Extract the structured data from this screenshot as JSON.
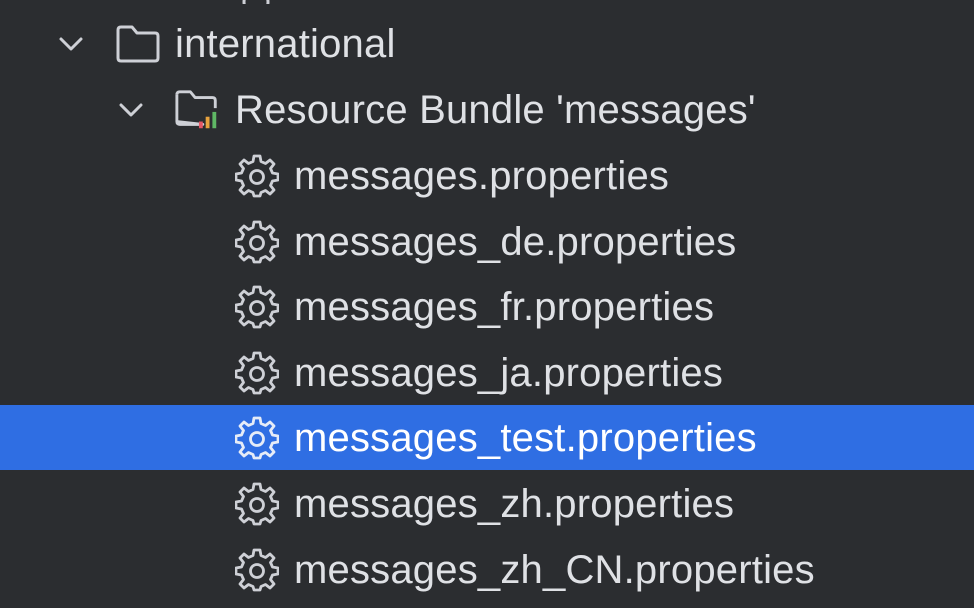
{
  "tree": {
    "items": [
      {
        "label": "international",
        "icon": "folder-icon",
        "expanded": true
      },
      {
        "label": "Resource Bundle 'messages'",
        "icon": "resource-bundle-icon",
        "expanded": true
      },
      {
        "label": "messages.properties",
        "icon": "gear-icon"
      },
      {
        "label": "messages_de.properties",
        "icon": "gear-icon"
      },
      {
        "label": "messages_fr.properties",
        "icon": "gear-icon"
      },
      {
        "label": "messages_ja.properties",
        "icon": "gear-icon"
      },
      {
        "label": "messages_test.properties",
        "icon": "gear-icon",
        "selected": true
      },
      {
        "label": "messages_zh.properties",
        "icon": "gear-icon"
      },
      {
        "label": "messages_zh_CN.properties",
        "icon": "gear-icon"
      }
    ]
  },
  "colors": {
    "background": "#2b2d30",
    "selection": "#2f6ee3",
    "text": "#dfe1e5",
    "icon": "#ced0d6"
  }
}
